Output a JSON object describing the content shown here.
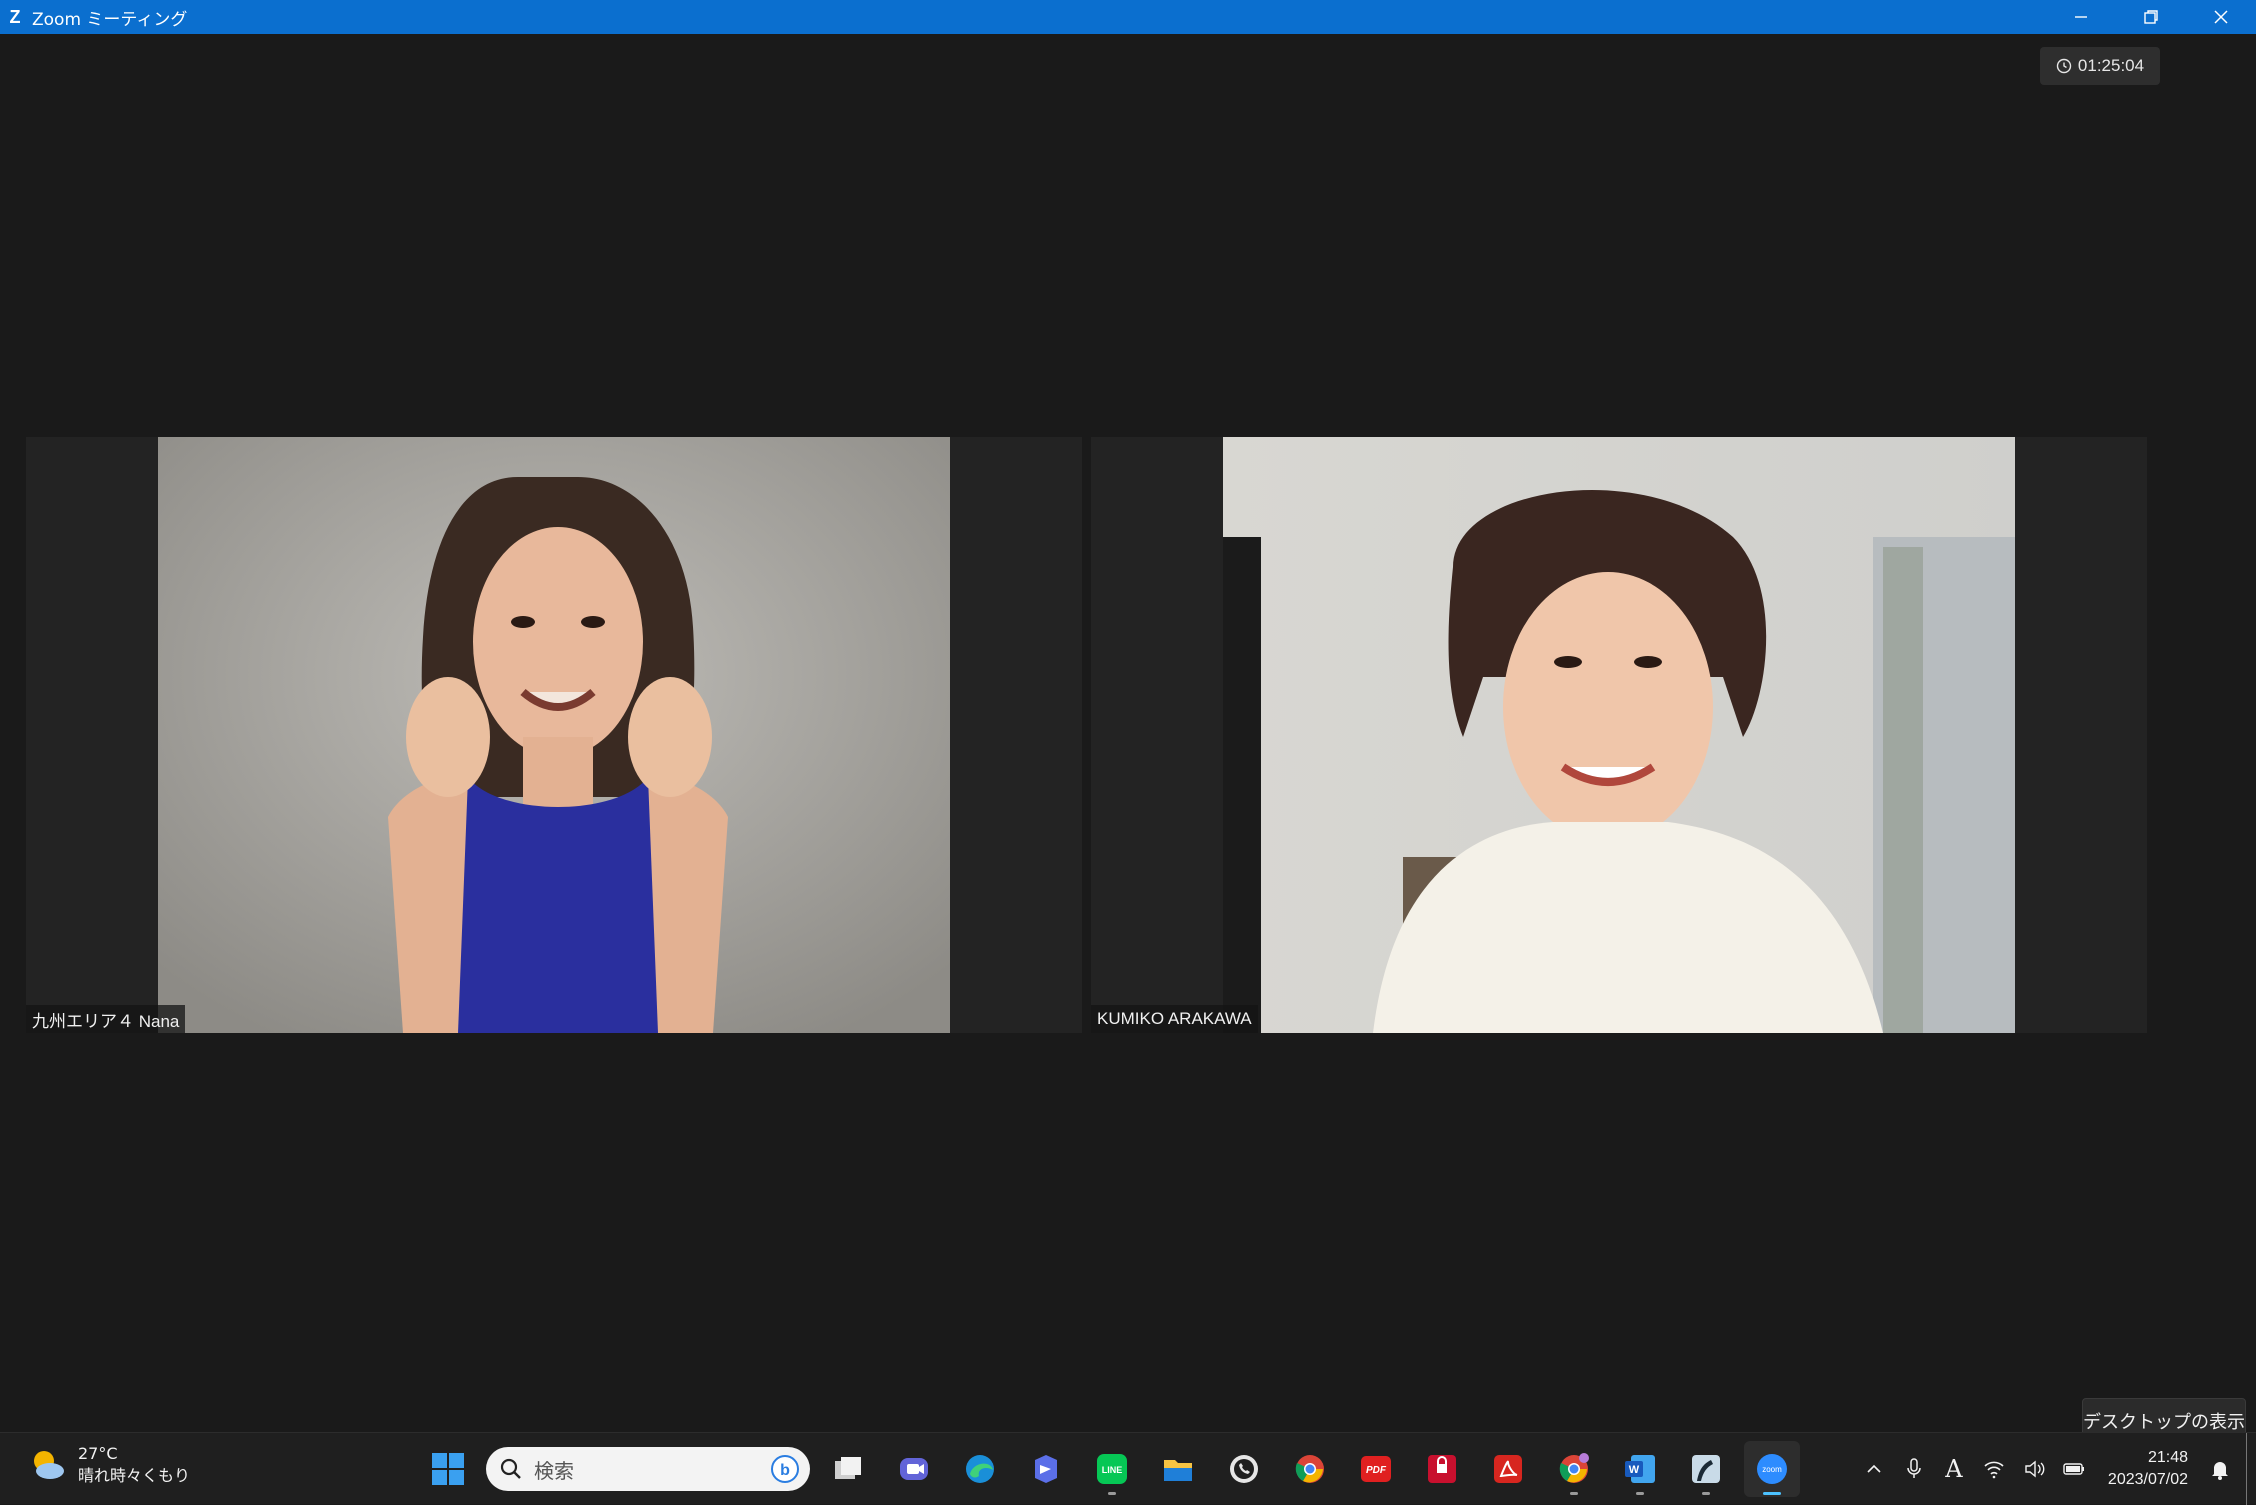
{
  "window": {
    "title": "Zoom ミーティング",
    "logo": "Z"
  },
  "meeting": {
    "timer": "01:25:04",
    "participants": [
      {
        "name": "九州エリア４ Nana"
      },
      {
        "name": "KUMIKO ARAKAWA"
      }
    ],
    "desktop_tooltip": "デスクトップの表示"
  },
  "taskbar": {
    "weather": {
      "temp": "27°C",
      "condition": "晴れ時々くもり",
      "icon": "partly-cloudy-icon"
    },
    "search_placeholder": "検索",
    "apps": [
      "windows-start-icon",
      "task-view-icon",
      "teams-chat-icon",
      "edge-icon",
      "copilot-icon",
      "line-icon",
      "file-explorer-icon",
      "whatsapp-icon",
      "chrome-icon",
      "pdf-app-icon",
      "mcafee-icon",
      "acrobat-icon",
      "chrome-profile-icon",
      "word-icon",
      "kindle-icon",
      "zoom-icon"
    ],
    "clock": {
      "time": "21:48",
      "date": "2023/07/02"
    },
    "ime_indicator": "A",
    "colors": {
      "zoom_blue": "#0b6fcf",
      "active_indicator": "#4cc2ff"
    }
  }
}
